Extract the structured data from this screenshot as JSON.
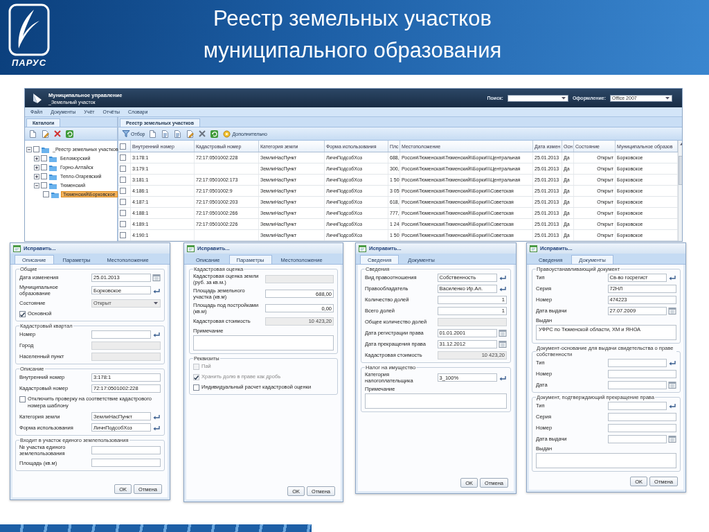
{
  "slide": {
    "logo_text": "ПАРУС",
    "title_lines": [
      "Реестр земельных участков",
      "муниципального образования"
    ]
  },
  "app": {
    "title": "Муниципальное управление",
    "subtitle": "_Земельный участок",
    "search_label": "Поиск:",
    "theme_label": "Оформление:",
    "theme_value": "Office 2007",
    "menu": [
      "Файл",
      "Документы",
      "Учёт",
      "Отчёты",
      "Словари"
    ],
    "left_tabs": [
      {
        "label": "Каталоги",
        "selected": true
      }
    ],
    "tree": [
      {
        "label": "_Реестр земельных участков",
        "checked": false,
        "selected": false,
        "expanded": true,
        "children": [
          {
            "label": "Беломорский",
            "checked": false,
            "selected": false,
            "expanded": false
          },
          {
            "label": "Горно-Алтайск",
            "checked": false,
            "selected": false,
            "expanded": false
          },
          {
            "label": "Тепло-Огаревский",
            "checked": false,
            "selected": false,
            "expanded": false
          },
          {
            "label": "Тюменский",
            "checked": false,
            "selected": false,
            "expanded": true,
            "children": [
              {
                "label": "Тюменский\\Борковское",
                "checked": false,
                "selected": true
              }
            ]
          }
        ]
      }
    ],
    "right_tabs": [
      {
        "label": "Реестр земельных участков",
        "selected": true
      }
    ],
    "toolbar": {
      "filter_label": "Отбор",
      "more_label": "Дополнительно"
    },
    "table": {
      "header_checked": false,
      "columns": [
        "Внутренний номер",
        "Кадастровый номер",
        "Категория земли",
        "Форма использования",
        "Плс",
        "Местоположение",
        "Дата измен",
        "Осн",
        "Состояние",
        "Муниципальное образов"
      ],
      "rows": [
        {
          "checked": false,
          "cells": [
            "3:178:1",
            "72:17:0501002:228",
            "ЗемлиНасПункт",
            "ЛичнПодсобХоз",
            "688,",
            "Россия\\Тюменская\\Тюменский\\\\Борки\\\\\\Центральная",
            "25.01.2013",
            "Да",
            "Открыт",
            "Борковское"
          ]
        },
        {
          "checked": false,
          "cells": [
            "3:179:1",
            null,
            "ЗемлиНасПункт",
            "ЛичнПодсобХоз",
            "300,",
            "Россия\\Тюменская\\Тюменский\\\\Борки\\\\\\Центральная",
            "25.01.2013",
            "Да",
            "Открыт",
            "Борковское"
          ]
        },
        {
          "checked": false,
          "cells": [
            "3:181:1",
            "72:17:0501002:173",
            "ЗемлиНасПункт",
            "ЛичнПодсобХоз",
            "1 50",
            "Россия\\Тюменская\\Тюменский\\\\Борки\\\\\\Центральная",
            "25.01.2013",
            "Да",
            "Открыт",
            "Борковское"
          ]
        },
        {
          "checked": false,
          "cells": [
            "4:186:1",
            "72:17:0501002:9",
            "ЗемлиНасПункт",
            "ЛичнПодсобХоз",
            "3 05",
            "Россия\\Тюменская\\Тюменский\\\\Борки\\\\\\Советская",
            "25.01.2013",
            "Да",
            "Открыт",
            "Борковское"
          ]
        },
        {
          "checked": false,
          "cells": [
            "4:187:1",
            "72:17:0501002:203",
            "ЗемлиНасПункт",
            "ЛичнПодсобХоз",
            "618,",
            "Россия\\Тюменская\\Тюменский\\\\Борки\\\\\\Советская",
            "25.01.2013",
            "Да",
            "Открыт",
            "Борковское"
          ]
        },
        {
          "checked": false,
          "cells": [
            "4:188:1",
            "72:17:0501002:266",
            "ЗемлиНасПункт",
            "ЛичнПодсобХоз",
            "777,",
            "Россия\\Тюменская\\Тюменский\\\\Борки\\\\\\Советская",
            "25.01.2013",
            "Да",
            "Открыт",
            "Борковское"
          ]
        },
        {
          "checked": false,
          "cells": [
            "4:189:1",
            "72:17:0501002:226",
            "ЗемлиНасПункт",
            "ЛичнПодсобХоз",
            "1 24",
            "Россия\\Тюменская\\Тюменский\\\\Борки\\\\\\Советская",
            "25.01.2013",
            "Да",
            "Открыт",
            "Борковское"
          ]
        },
        {
          "checked": false,
          "cells": [
            "4:190:1",
            null,
            "ЗемлиНасПункт",
            "ЛичнПодсобХоз",
            "1 50",
            "Россия\\Тюменская\\Тюменский\\\\Борки\\\\\\Советская",
            "25.01.2013",
            "Да",
            "Открыт",
            "Борковское"
          ]
        }
      ]
    }
  },
  "dialogs": [
    {
      "title": "Исправить...",
      "tabs": [
        {
          "label": "Описание",
          "selected": true
        },
        {
          "label": "Параметры",
          "selected": false
        },
        {
          "label": "Местоположение",
          "selected": false
        }
      ],
      "groups": [
        {
          "legend": "Общие",
          "rows": [
            {
              "kind": "date-field",
              "label": "Дата изменения",
              "value": "25.01.2013",
              "disabled": false
            },
            {
              "kind": "lookup-field",
              "label": "Муниципальное образование",
              "value": "Борковское",
              "disabled": false
            },
            {
              "kind": "dropdown-field",
              "label": "Состояние",
              "value": "Открыт",
              "disabled": true
            },
            {
              "kind": "checkbox",
              "label": "Основной",
              "checked": true,
              "disabled": false
            }
          ]
        },
        {
          "legend": "Кадастровый квартал",
          "rows": [
            {
              "kind": "lookup-field",
              "label": "Номер",
              "disabled": false
            },
            {
              "kind": "field",
              "label": "Город",
              "disabled": true
            },
            {
              "kind": "field",
              "label": "Населенный пункт",
              "disabled": true
            }
          ]
        },
        {
          "legend": "Описание",
          "rows": [
            {
              "kind": "field",
              "label": "Внутренний номер",
              "value": "3:178:1",
              "disabled": false
            },
            {
              "kind": "field",
              "label": "Кадастровый номер",
              "value": "72:17:0501002:228",
              "disabled": false
            },
            {
              "kind": "checkbox",
              "label": "Отключить проверку на соответствие кадастрового номера шаблону",
              "checked": false,
              "disabled": false
            },
            {
              "kind": "lookup-field",
              "label": "Категория земли",
              "value": "ЗемлиНасПункт",
              "disabled": false
            },
            {
              "kind": "lookup-field",
              "label": "Форма использования",
              "value": "ЛичнПодсобХоз",
              "disabled": false
            }
          ]
        },
        {
          "legend": "Входит в участок единого землепользования",
          "rows": [
            {
              "kind": "field",
              "label": "№ участка единого землепользования",
              "disabled": false
            },
            {
              "kind": "field",
              "label": "Площадь (кв.м)",
              "disabled": false
            }
          ]
        }
      ],
      "buttons": [
        "OK",
        "Отмена"
      ]
    },
    {
      "title": "Исправить...",
      "tabs": [
        {
          "label": "Описание",
          "selected": false
        },
        {
          "label": "Параметры",
          "selected": true
        },
        {
          "label": "Местоположение",
          "selected": false
        }
      ],
      "groups": [
        {
          "legend": "Кадастровая оценка",
          "rows": [
            {
              "kind": "number-field",
              "label": "Кадастровая оценка земли (руб. за кв.м.)",
              "disabled": true
            },
            {
              "kind": "number-field",
              "label": "Площадь земельного участка (кв.м)",
              "value": "688,00",
              "disabled": false
            },
            {
              "kind": "number-field",
              "label": "Площадь под постройками (кв.м)",
              "value": "0,00",
              "disabled": false
            },
            {
              "kind": "number-field",
              "label": "Кадастровая стоимость",
              "value": "10 423,20",
              "disabled": true
            },
            {
              "kind": "note",
              "label": "Примечание"
            }
          ]
        },
        {
          "legend": "Реквизиты",
          "rows": [
            {
              "kind": "checkbox",
              "label": "Пай",
              "checked": false,
              "disabled": true
            },
            {
              "kind": "checkbox",
              "label": "Хранить долю в праве как дробь",
              "checked": true,
              "disabled": true
            },
            {
              "kind": "checkbox",
              "label": "Индивидуальный расчет кадастровой оценки",
              "checked": false,
              "disabled": false
            }
          ]
        }
      ],
      "buttons": [
        "OK",
        "Отмена"
      ]
    },
    {
      "title": "Исправить...",
      "tabs": [
        {
          "label": "Сведения",
          "selected": true
        },
        {
          "label": "Документы",
          "selected": false
        }
      ],
      "groups": [
        {
          "legend": "Сведения",
          "rows": [
            {
              "kind": "lookup-field",
              "label": "Вид правоотношения",
              "value": "Собственность",
              "disabled": false
            },
            {
              "kind": "lookup-field",
              "label": "Правообладатель",
              "value": "Василенко Ир.Ал.",
              "disabled": false
            },
            {
              "kind": "number-field",
              "label": "Количество долей",
              "value": "1",
              "disabled": false
            },
            {
              "kind": "number-field",
              "label": "Всего долей",
              "value": "1",
              "disabled": false
            },
            {
              "kind": "number-field",
              "label": "Общее количество долей",
              "disabled": true
            },
            {
              "kind": "date-field",
              "label": "Дата регистрации права",
              "value": "01.01.2001",
              "disabled": false
            },
            {
              "kind": "date-field",
              "label": "Дата прекращения права",
              "value": "31.12.2012",
              "disabled": false
            },
            {
              "kind": "number-field",
              "label": "Кадастровая стоимость",
              "value": "10 423,20",
              "disabled": true
            }
          ]
        },
        {
          "legend": "Налог на имущество",
          "rows": [
            {
              "kind": "lookup-field",
              "label": "Категория налогоплательщика",
              "value": "3_100%",
              "disabled": false
            },
            {
              "kind": "note",
              "label": "Примечание"
            }
          ]
        }
      ],
      "buttons": [
        "OK",
        "Отмена"
      ]
    },
    {
      "title": "Исправить...",
      "tabs": [
        {
          "label": "Сведения",
          "selected": false
        },
        {
          "label": "Документы",
          "selected": true
        }
      ],
      "groups": [
        {
          "legend": "Правоустанавливающий документ",
          "rows": [
            {
              "kind": "lookup-field",
              "label": "Тип",
              "value": "Св-во госрегист",
              "disabled": false
            },
            {
              "kind": "field",
              "label": "Серия",
              "value": "72НЛ",
              "disabled": false
            },
            {
              "kind": "field",
              "label": "Номер",
              "value": "474223",
              "disabled": false
            },
            {
              "kind": "date-field",
              "label": "Дата выдачи",
              "value": "27.07.2009",
              "disabled": false
            },
            {
              "kind": "note",
              "label": "Выдан",
              "value": "УФРС по Тюменской области, ХМ и ЯНОА"
            }
          ]
        },
        {
          "legend": "Документ-основание для выдачи свидетельства о праве собственности",
          "rows": [
            {
              "kind": "lookup-field",
              "label": "Тип",
              "disabled": false
            },
            {
              "kind": "field",
              "label": "Номер",
              "disabled": false
            },
            {
              "kind": "date-field",
              "label": "Дата",
              "disabled": false
            }
          ]
        },
        {
          "legend": "Документ, подтверждающий прекращение права",
          "rows": [
            {
              "kind": "lookup-field",
              "label": "Тип",
              "disabled": false
            },
            {
              "kind": "field",
              "label": "Серия",
              "disabled": false
            },
            {
              "kind": "field",
              "label": "Номер",
              "disabled": false
            },
            {
              "kind": "date-field",
              "label": "Дата выдачи",
              "disabled": false
            },
            {
              "kind": "note",
              "label": "Выдан"
            }
          ]
        }
      ],
      "buttons": [
        "OK",
        "Отмена"
      ]
    }
  ]
}
